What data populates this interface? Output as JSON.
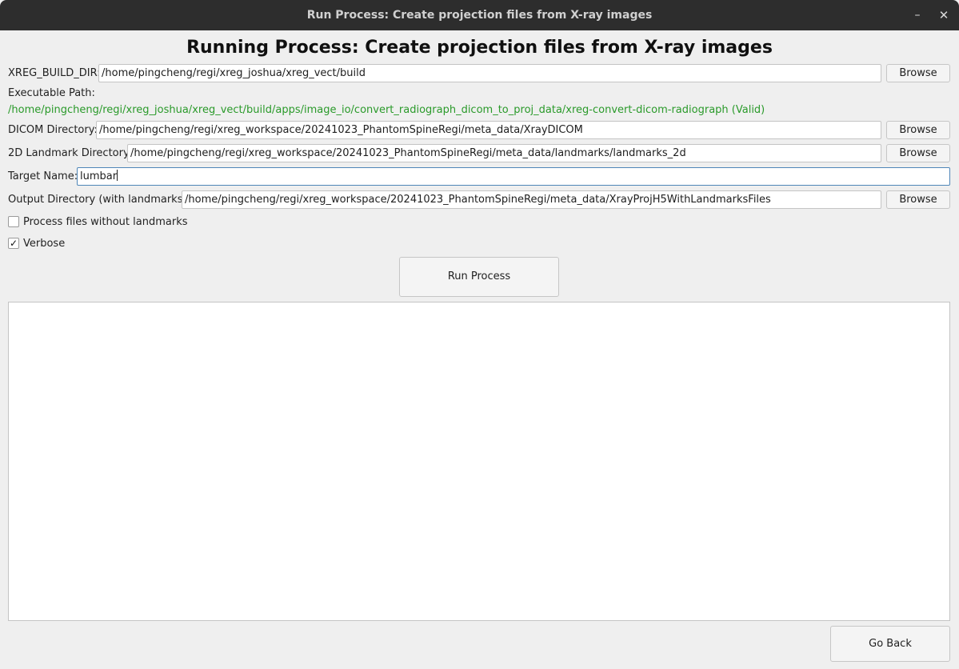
{
  "window": {
    "title": "Run Process: Create projection files from X-ray images",
    "minimize_glyph": "–",
    "close_glyph": "✕"
  },
  "heading": "Running Process: Create projection files from X-ray images",
  "build_dir": {
    "label": "XREG_BUILD_DIR:",
    "value": "/home/pingcheng/regi/xreg_joshua/xreg_vect/build",
    "browse": "Browse"
  },
  "executable": {
    "label": "Executable Path:",
    "path": "/home/pingcheng/regi/xreg_joshua/xreg_vect/build/apps/image_io/convert_radiograph_dicom_to_proj_data/xreg-convert-dicom-radiograph (Valid)",
    "status_color": "#2a9a2a"
  },
  "dicom_dir": {
    "label": "DICOM Directory:",
    "value": "/home/pingcheng/regi/xreg_workspace/20241023_PhantomSpineRegi/meta_data/XrayDICOM",
    "browse": "Browse"
  },
  "landmark_dir": {
    "label": "2D Landmark Directory:",
    "value": "/home/pingcheng/regi/xreg_workspace/20241023_PhantomSpineRegi/meta_data/landmarks/landmarks_2d",
    "browse": "Browse"
  },
  "target_name": {
    "label": "Target Name:",
    "value": "lumbar"
  },
  "output_dir": {
    "label": "Output Directory (with landmarks):",
    "value": "/home/pingcheng/regi/xreg_workspace/20241023_PhantomSpineRegi/meta_data/XrayProjH5WithLandmarksFiles",
    "browse": "Browse"
  },
  "options": {
    "no_landmarks": {
      "label": "Process files without landmarks",
      "checked": false
    },
    "verbose": {
      "label": "Verbose",
      "checked": true
    }
  },
  "check_glyph": "✓",
  "actions": {
    "run": "Run Process",
    "go_back": "Go Back"
  },
  "console_output": ""
}
